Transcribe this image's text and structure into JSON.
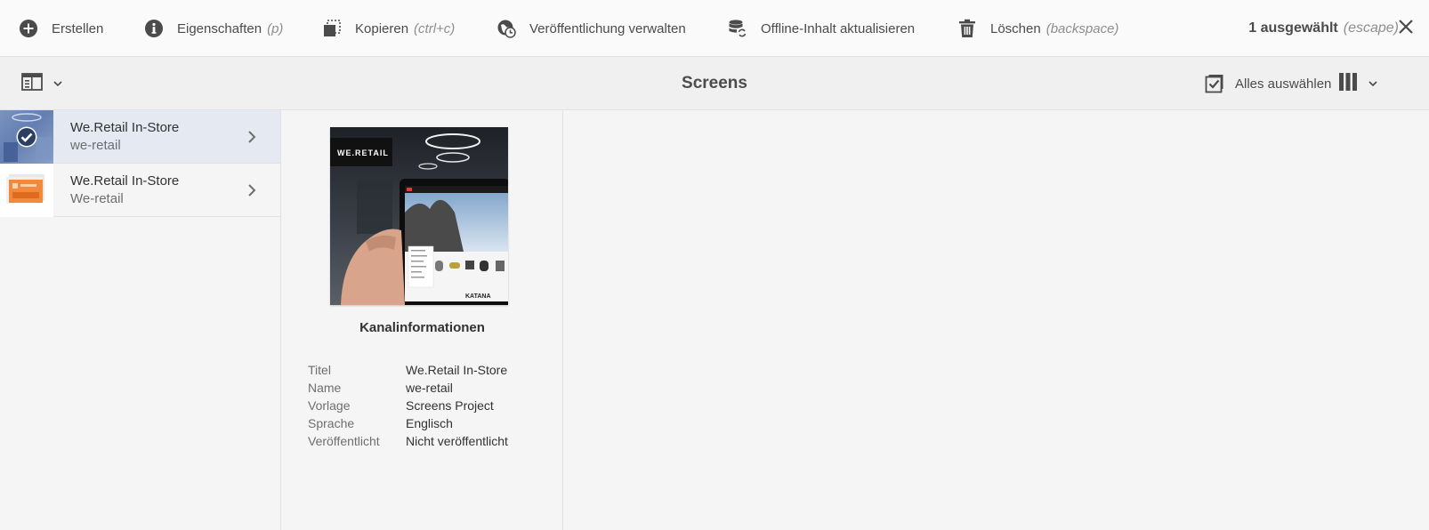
{
  "actionbar": {
    "create": {
      "label": "Erstellen",
      "icon": "plus-circle-icon"
    },
    "properties": {
      "label": "Eigenschaften",
      "hint": "(p)",
      "icon": "info-icon"
    },
    "copy": {
      "label": "Kopieren",
      "hint": "(ctrl+c)",
      "icon": "copy-icon"
    },
    "publish": {
      "label": "Veröffentlichung verwalten",
      "icon": "globe-clock-icon"
    },
    "offline": {
      "label": "Offline-Inhalt aktualisieren",
      "icon": "database-refresh-icon"
    },
    "delete": {
      "label": "Löschen",
      "hint": "(backspace)",
      "icon": "trash-icon"
    },
    "selection": {
      "count_label": "1 ausgewählt",
      "hint": "(escape)"
    }
  },
  "titlebar": {
    "title": "Screens",
    "select_all_label": "Alles auswählen"
  },
  "column1": {
    "items": [
      {
        "title": "We.Retail In-Store",
        "subtitle": "we-retail",
        "selected": true
      },
      {
        "title": "We.Retail In-Store",
        "subtitle": "We-retail",
        "selected": false
      }
    ]
  },
  "preview": {
    "image_text": {
      "logo": "WE.RETAIL",
      "headline": "KATANA"
    },
    "info_title": "Kanalinformationen",
    "meta": [
      {
        "key": "Titel",
        "value": "We.Retail In-Store"
      },
      {
        "key": "Name",
        "value": "we-retail"
      },
      {
        "key": "Vorlage",
        "value": "Screens Project"
      },
      {
        "key": "Sprache",
        "value": "Englisch"
      },
      {
        "key": "Veröffentlicht",
        "value": "Nicht veröffentlicht"
      }
    ]
  },
  "colors": {
    "selected_row": "#e4e9f2",
    "text": "#4b4b4b",
    "hint": "#8e8e8e",
    "icon": "#4b4b4b"
  }
}
